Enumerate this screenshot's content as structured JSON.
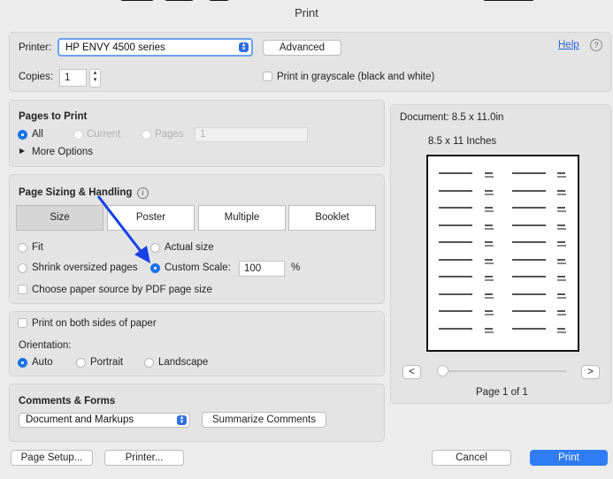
{
  "window": {
    "title": "Print"
  },
  "printer": {
    "label": "Printer:",
    "value": "HP ENVY 4500 series",
    "advanced": "Advanced",
    "help": "Help",
    "help_icon": "?"
  },
  "copies": {
    "label": "Copies:",
    "value": "1",
    "grayscale": "Print in grayscale (black and white)"
  },
  "pages": {
    "heading": "Pages to Print",
    "all": "All",
    "current": "Current",
    "pages": "Pages",
    "pages_value": "1",
    "more": "More Options"
  },
  "sizing": {
    "heading": "Page Sizing & Handling",
    "info_icon": "i",
    "tabs": [
      "Size",
      "Poster",
      "Multiple",
      "Booklet"
    ],
    "fit": "Fit",
    "actual": "Actual size",
    "shrink": "Shrink oversized pages",
    "custom": "Custom Scale:",
    "custom_value": "100",
    "percent": "%",
    "paper_source": "Choose paper source by PDF page size"
  },
  "duplex": {
    "label": "Print on both sides of paper",
    "orientation": "Orientation:",
    "auto": "Auto",
    "portrait": "Portrait",
    "landscape": "Landscape"
  },
  "comments": {
    "heading": "Comments & Forms",
    "value": "Document and Markups",
    "summarize": "Summarize Comments"
  },
  "preview": {
    "document": "Document: 8.5 x 11.0in",
    "size": "8.5 x 11 Inches",
    "prev": "<",
    "next": ">",
    "page": "Page 1 of 1"
  },
  "footer": {
    "page_setup": "Page Setup...",
    "printer": "Printer...",
    "cancel": "Cancel",
    "print": "Print"
  },
  "colors": {
    "accent": "#1a73e8",
    "annotation_arrow": "#1740e6"
  }
}
